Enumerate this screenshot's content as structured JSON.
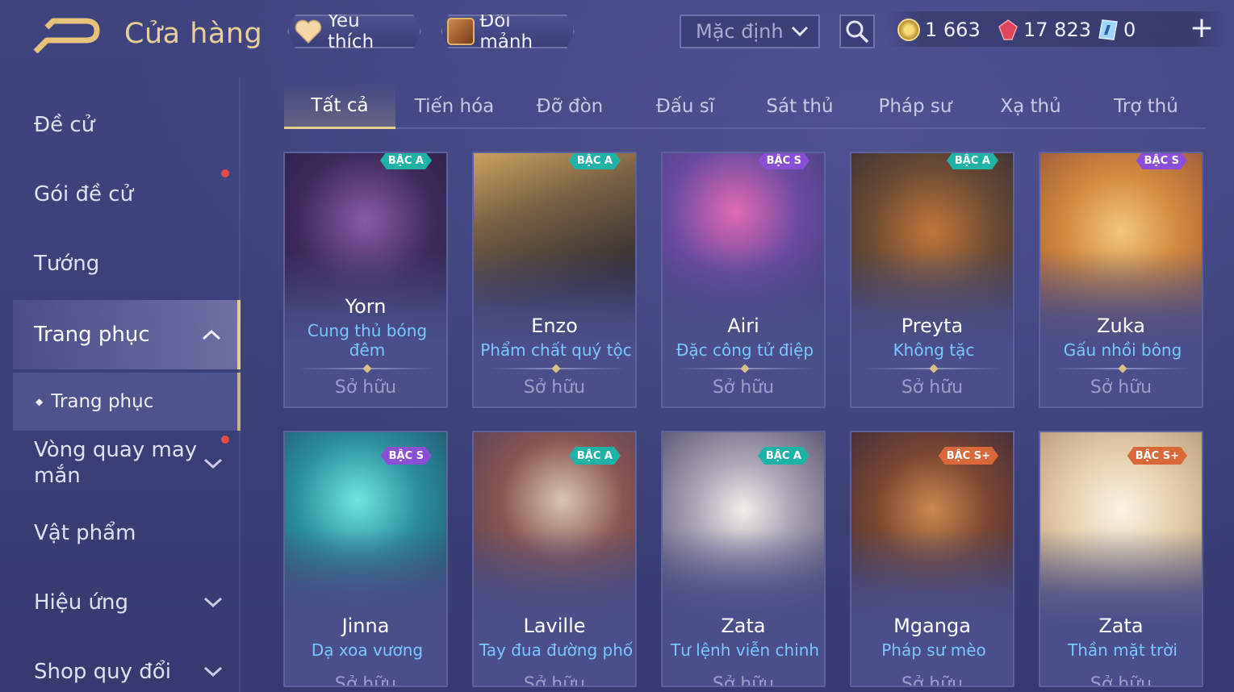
{
  "header": {
    "title": "Cửa hàng",
    "favorite_label": "Yêu thích",
    "fragments_label": "Đổi mảnh",
    "sort_value": "Mặc định",
    "currencies": {
      "gold": "1 663",
      "ruby": "17 823",
      "voucher": "0"
    },
    "add_label": "+"
  },
  "sidebar": {
    "items": [
      {
        "label": "Đề cử"
      },
      {
        "label": "Gói đề cử"
      },
      {
        "label": "Tướng"
      },
      {
        "label": "Trang phục"
      },
      {
        "label": "Trang phục"
      },
      {
        "label": "Vòng quay may mắn"
      },
      {
        "label": "Vật phẩm"
      },
      {
        "label": "Hiệu ứng"
      },
      {
        "label": "Shop quy đổi"
      }
    ]
  },
  "tabs": [
    "Tất cả",
    "Tiến hóa",
    "Đỡ đòn",
    "Đấu sĩ",
    "Sát thủ",
    "Pháp sư",
    "Xạ thủ",
    "Trợ thủ"
  ],
  "colors": {
    "accent_gold": "#e6cc8e",
    "skin_name_blue": "#79c8ff",
    "badge_a": "#1fb3a8",
    "badge_s": "#8b4fd6",
    "badge_splus": "#d9683a"
  },
  "cards": [
    {
      "name": "Yorn",
      "skin": "Cung thủ bóng đêm",
      "status": "Sở hữu",
      "badge": "BẬC A"
    },
    {
      "name": "Enzo",
      "skin": "Phẩm chất quý tộc",
      "status": "Sở hữu",
      "badge": "BẬC A"
    },
    {
      "name": "Airi",
      "skin": "Đặc công tử điệp",
      "status": "Sở hữu",
      "badge": "BẬC S"
    },
    {
      "name": "Preyta",
      "skin": "Không tặc",
      "status": "Sở hữu",
      "badge": "BẬC A"
    },
    {
      "name": "Zuka",
      "skin": "Gấu nhồi bông",
      "status": "Sở hữu",
      "badge": "BẬC S"
    },
    {
      "name": "Jinna",
      "skin": "Dạ xoa vương",
      "status": "Sở hữu",
      "badge": "BẬC S"
    },
    {
      "name": "Laville",
      "skin": "Tay đua đường phố",
      "status": "Sở hữu",
      "badge": "BẬC A"
    },
    {
      "name": "Zata",
      "skin": "Tư lệnh viễn chinh",
      "status": "Sở hữu",
      "badge": "BẬC A"
    },
    {
      "name": "Mganga",
      "skin": "Pháp sư mèo",
      "status": "Sở hữu",
      "badge": "BẬC S+"
    },
    {
      "name": "Zata",
      "skin": "Thần mặt trời",
      "status": "Sở hữu",
      "badge": "BẬC S+"
    }
  ]
}
